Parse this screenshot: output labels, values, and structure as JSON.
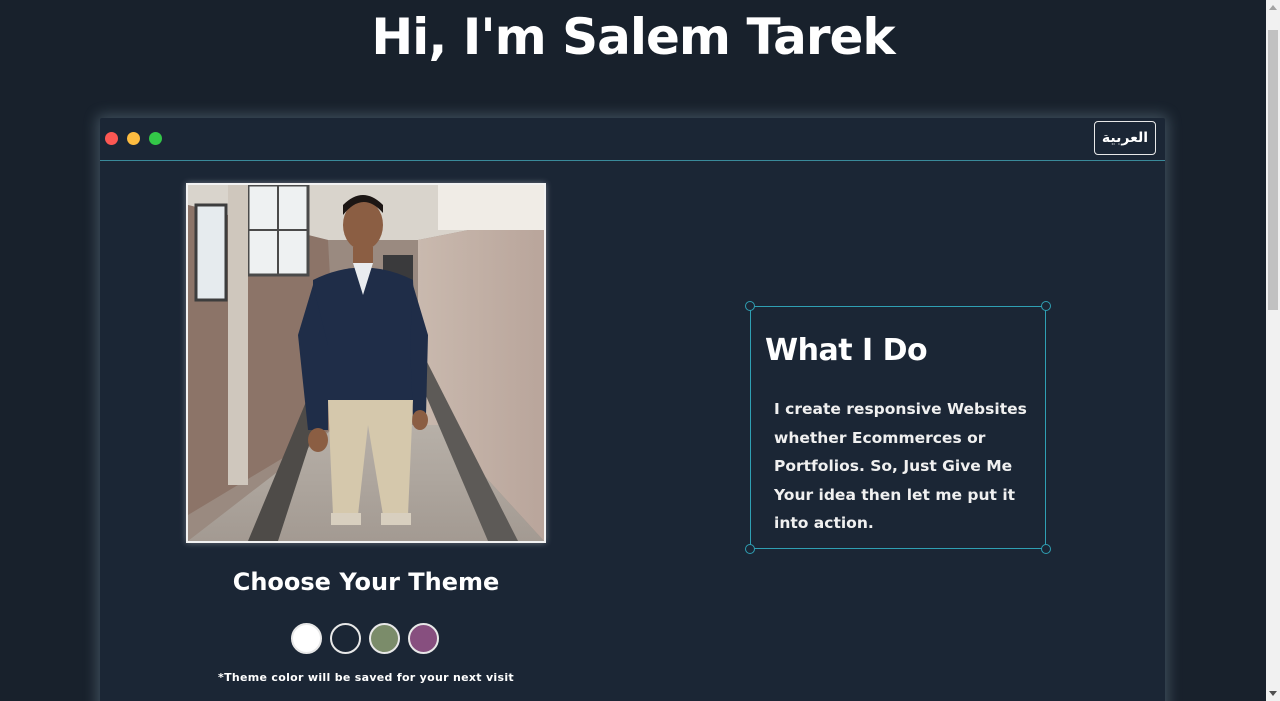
{
  "header": {
    "title": "Hi, I'm Salem Tarek"
  },
  "window": {
    "dots": [
      "red",
      "yellow",
      "green"
    ],
    "language_button": "العربية"
  },
  "profile": {
    "photo_alt": "Salem Tarek portrait"
  },
  "theme": {
    "title": "Choose Your Theme",
    "note": "*Theme color will be saved for your next visit",
    "swatches": [
      {
        "name": "light",
        "color": "#ffffff"
      },
      {
        "name": "dark",
        "color": "#1b2635"
      },
      {
        "name": "green",
        "color": "#7b8c6a"
      },
      {
        "name": "purple",
        "color": "#874f7f"
      }
    ]
  },
  "what_i_do": {
    "title": "What I Do",
    "text": "I create responsive Websites whether Ecommerces or Portfolios. So, Just Give Me Your idea then let me put it into action."
  },
  "colors": {
    "background": "#18212c",
    "window": "#1b2635",
    "accent": "#2f9fb3"
  }
}
